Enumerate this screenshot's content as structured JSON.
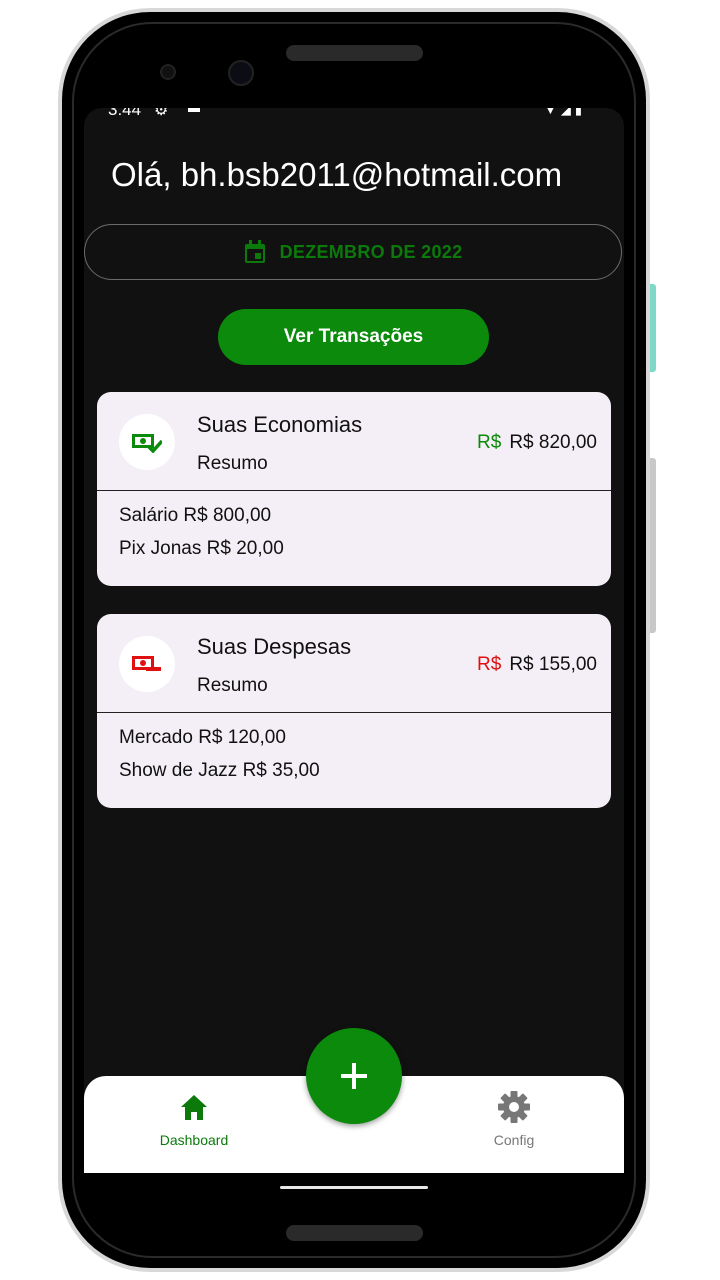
{
  "status": {
    "time": "3:44"
  },
  "greeting": "Olá, bh.bsb2011@hotmail.com",
  "month_label": "DEZEMBRO DE 2022",
  "view_transactions_label": "Ver Transações",
  "colors": {
    "accent": "#0b8a0b",
    "income": "#0b8a0b",
    "expense": "#e01010",
    "screen_bg": "#111111",
    "card_bg": "#f4eff6"
  },
  "savings": {
    "title": "Suas Economias",
    "subtitle": "Resumo",
    "currency": "R$",
    "total": "R$ 820,00",
    "items": [
      "Salário R$ 800,00",
      "Pix Jonas R$ 20,00"
    ],
    "icon": "money-check-icon"
  },
  "expenses": {
    "title": "Suas Despesas",
    "subtitle": "Resumo",
    "currency": "R$",
    "total": "R$ 155,00",
    "items": [
      "Mercado R$ 120,00",
      "Show de Jazz R$ 35,00"
    ],
    "icon": "money-minus-icon"
  },
  "nav": {
    "dashboard": "Dashboard",
    "config": "Config"
  }
}
